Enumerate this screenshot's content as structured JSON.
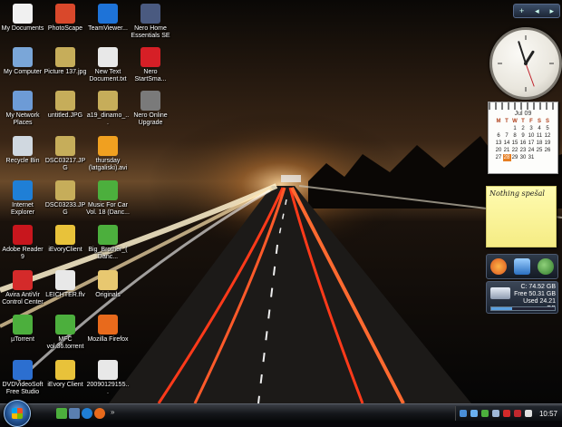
{
  "desktop": {
    "icons": [
      {
        "label": "My Documents",
        "icon": "folder-documents-icon",
        "color": "#f0f0f0"
      },
      {
        "label": "PhotoScape",
        "icon": "photoscape-icon",
        "color": "#d9482b"
      },
      {
        "label": "TeamViewer...",
        "icon": "teamviewer-icon",
        "color": "#1e73d8"
      },
      {
        "label": "Nero Home Essentials SE",
        "icon": "nero-icon",
        "color": "#4a5a80"
      },
      {
        "label": "My Computer",
        "icon": "computer-icon",
        "color": "#7aa6d8"
      },
      {
        "label": "Picture 137.jpg",
        "icon": "image-file-icon",
        "color": "#c6ad5a"
      },
      {
        "label": "New Text Document.txt",
        "icon": "text-file-icon",
        "color": "#e8e8e8"
      },
      {
        "label": "Nero StartSma...",
        "icon": "nero-startsmart-icon",
        "color": "#d61f26"
      },
      {
        "label": "My Network Places",
        "icon": "network-icon",
        "color": "#6d9bd6"
      },
      {
        "label": "untitled.JPG",
        "icon": "image-file-icon",
        "color": "#c6ad5a"
      },
      {
        "label": "a19_dinamo_...",
        "icon": "image-file-icon",
        "color": "#c6ad5a"
      },
      {
        "label": "Nero Online Upgrade",
        "icon": "nero-upgrade-icon",
        "color": "#7a7a7a"
      },
      {
        "label": "Recycle Bin",
        "icon": "recycle-bin-icon",
        "color": "#d0d8e0"
      },
      {
        "label": "DSC03217.JPG",
        "icon": "image-file-icon",
        "color": "#c6ad5a"
      },
      {
        "label": "DSC03233.JPG",
        "icon": "image-file-icon",
        "color": "#c6ad5a"
      },
      {
        "label": "thursday (latgaliski).avi",
        "icon": "video-file-icon",
        "color": "#f0a020"
      },
      {
        "label": "Internet Explorer",
        "icon": "internet-explorer-icon",
        "color": "#1f7fd6"
      },
      {
        "label": "Music For Car Vol. 18 (Danc...",
        "icon": "utorrent-file-icon",
        "color": "#4caf3d"
      },
      {
        "label": "Adobe Reader 9",
        "icon": "adobe-reader-icon",
        "color": "#c8161d"
      },
      {
        "label": "iEvoryClient",
        "icon": "ievory-icon",
        "color": "#e8c23a"
      },
      {
        "label": "Big_Brother_(Danc...",
        "icon": "utorrent-file-icon",
        "color": "#4caf3d"
      },
      {
        "label": "Avira AntiVir Control Center",
        "icon": "avira-icon",
        "color": "#d42a2a"
      },
      {
        "label": "LEICHTER.flv",
        "icon": "flv-file-icon",
        "color": "#e8e8e8"
      },
      {
        "label": "Originals",
        "icon": "folder-icon",
        "color": "#e8c870"
      },
      {
        "label": "µTorrent",
        "icon": "utorrent-icon",
        "color": "#4caf3d"
      },
      {
        "label": "MFC vol.36.torrent",
        "icon": "utorrent-file-icon",
        "color": "#4caf3d"
      },
      {
        "label": "Mozilla Firefox",
        "icon": "firefox-icon",
        "color": "#e86a1c"
      },
      {
        "label": "DVDVideoSoft Free Studio",
        "icon": "dvdvideosoft-icon",
        "color": "#2c6fd0"
      },
      {
        "label": "iEvory Client",
        "icon": "ievory-icon",
        "color": "#e8c23a"
      },
      {
        "label": "20090129155...",
        "icon": "file-icon",
        "color": "#e8e8e8"
      }
    ]
  },
  "sidebar": {
    "controls": {
      "add": "+",
      "prev": "◂",
      "next": "▸"
    },
    "calendar": {
      "month": "Jul 09",
      "weekdays": [
        "M",
        "T",
        "W",
        "T",
        "F",
        "S",
        "S"
      ],
      "rows": [
        [
          "",
          "",
          "1",
          "2",
          "3",
          "4",
          "5"
        ],
        [
          "6",
          "7",
          "8",
          "9",
          "10",
          "11",
          "12"
        ],
        [
          "13",
          "14",
          "15",
          "16",
          "17",
          "18",
          "19"
        ],
        [
          "20",
          "21",
          "22",
          "23",
          "24",
          "25",
          "26"
        ],
        [
          "27",
          "28",
          "29",
          "30",
          "31",
          "",
          ""
        ]
      ],
      "today": "28"
    },
    "note": {
      "text": "Nothing spešal"
    },
    "drive": {
      "label": "C:",
      "size": "74.52 GB",
      "free_label": "Free",
      "free": "50.31 GB",
      "used_label": "Used",
      "used": "24.21 GB",
      "used_fraction": 0.325
    }
  },
  "taskbar": {
    "time": "10:57",
    "start_label": "Start"
  }
}
